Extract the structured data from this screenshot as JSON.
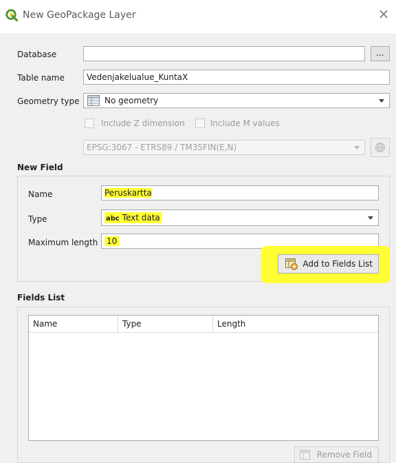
{
  "window": {
    "title": "New GeoPackage Layer",
    "close_glyph": "×"
  },
  "form": {
    "database": {
      "label": "Database",
      "value": "",
      "browse_label": "..."
    },
    "table_name": {
      "label": "Table name",
      "value": "Vedenjakelualue_KuntaX"
    },
    "geometry_type": {
      "label": "Geometry type",
      "value": "No geometry",
      "icon": "table-grid-icon"
    },
    "include_z": {
      "label": "Include Z dimension",
      "checked": false
    },
    "include_m": {
      "label": "Include M values",
      "checked": false
    },
    "crs": {
      "value": "EPSG:3067 - ETRS89 / TM35FIN(E,N)"
    }
  },
  "new_field": {
    "section_title": "New Field",
    "name": {
      "label": "Name",
      "value": "Peruskartta"
    },
    "type": {
      "label": "Type",
      "prefix": "abc",
      "value": "Text data"
    },
    "max_length": {
      "label": "Maximum length",
      "value": "10"
    },
    "add_button_label": "Add to Fields List"
  },
  "fields_list": {
    "section_title": "Fields List",
    "columns": [
      "Name",
      "Type",
      "Length"
    ],
    "rows": [],
    "remove_button_label": "Remove Field"
  },
  "colors": {
    "highlight": "#ffff33",
    "qgis_green": "#589632",
    "qgis_yellow": "#f0c419"
  }
}
